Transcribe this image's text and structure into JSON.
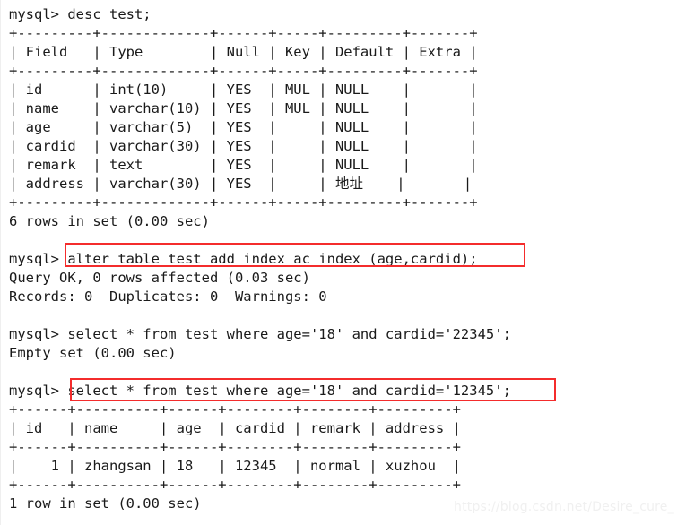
{
  "window": {
    "type": "mysql-terminal",
    "background_color": "#ffffff",
    "text_color": "#1a1a1a",
    "highlight_color": "#f42c2c"
  },
  "console": {
    "lines": [
      "mysql> desc test;",
      "+---------+-------------+------+-----+---------+-------+",
      "| Field   | Type        | Null | Key | Default | Extra |",
      "+---------+-------------+------+-----+---------+-------+",
      "| id      | int(10)     | YES  | MUL | NULL    |       |",
      "| name    | varchar(10) | YES  | MUL | NULL    |       |",
      "| age     | varchar(5)  | YES  |     | NULL    |       |",
      "| cardid  | varchar(30) | YES  |     | NULL    |       |",
      "| remark  | text        | YES  |     | NULL    |       |",
      "| address | varchar(30) | YES  |     | 地址    |       |",
      "+---------+-------------+------+-----+---------+-------+",
      "6 rows in set (0.00 sec)",
      "",
      "mysql> alter table test add index ac_index (age,cardid);",
      "Query OK, 0 rows affected (0.03 sec)",
      "Records: 0  Duplicates: 0  Warnings: 0",
      "",
      "mysql> select * from test where age='18' and cardid='22345';",
      "Empty set (0.00 sec)",
      "",
      "mysql> select * from test where age='18' and cardid='12345';",
      "+------+----------+------+--------+--------+---------+",
      "| id   | name     | age  | cardid | remark | address |",
      "+------+----------+------+--------+--------+---------+",
      "|    1 | zhangsan | 18   | 12345  | normal | xuzhou  |",
      "+------+----------+------+--------+--------+---------+",
      "1 row in set (0.00 sec)"
    ]
  },
  "desc_table": {
    "command": "desc test;",
    "columns": [
      "Field",
      "Type",
      "Null",
      "Key",
      "Default",
      "Extra"
    ],
    "rows": [
      [
        "id",
        "int(10)",
        "YES",
        "MUL",
        "NULL",
        ""
      ],
      [
        "name",
        "varchar(10)",
        "YES",
        "MUL",
        "NULL",
        ""
      ],
      [
        "age",
        "varchar(5)",
        "YES",
        "",
        "NULL",
        ""
      ],
      [
        "cardid",
        "varchar(30)",
        "YES",
        "",
        "NULL",
        ""
      ],
      [
        "remark",
        "text",
        "YES",
        "",
        "NULL",
        ""
      ],
      [
        "address",
        "varchar(30)",
        "YES",
        "",
        "地址",
        ""
      ]
    ],
    "status": "6 rows in set (0.00 sec)"
  },
  "alter_statement": {
    "prompt": "mysql>",
    "command": "alter table test add index ac_index (age,cardid);",
    "result": "Query OK, 0 rows affected (0.03 sec)",
    "records": "Records: 0  Duplicates: 0  Warnings: 0",
    "highlighted": true
  },
  "select_empty": {
    "prompt": "mysql>",
    "command": "select * from test where age='18' and cardid='22345';",
    "result": "Empty set (0.00 sec)",
    "highlighted": false
  },
  "select_result": {
    "prompt": "mysql>",
    "command": "select * from test where age='18' and cardid='12345';",
    "highlighted": true,
    "columns": [
      "id",
      "name",
      "age",
      "cardid",
      "remark",
      "address"
    ],
    "rows": [
      [
        "1",
        "zhangsan",
        "18",
        "12345",
        "normal",
        "xuzhou"
      ]
    ],
    "status": "1 row in set (0.00 sec)"
  },
  "watermark": {
    "text": "https://blog.csdn.net/Desire_cure_"
  }
}
